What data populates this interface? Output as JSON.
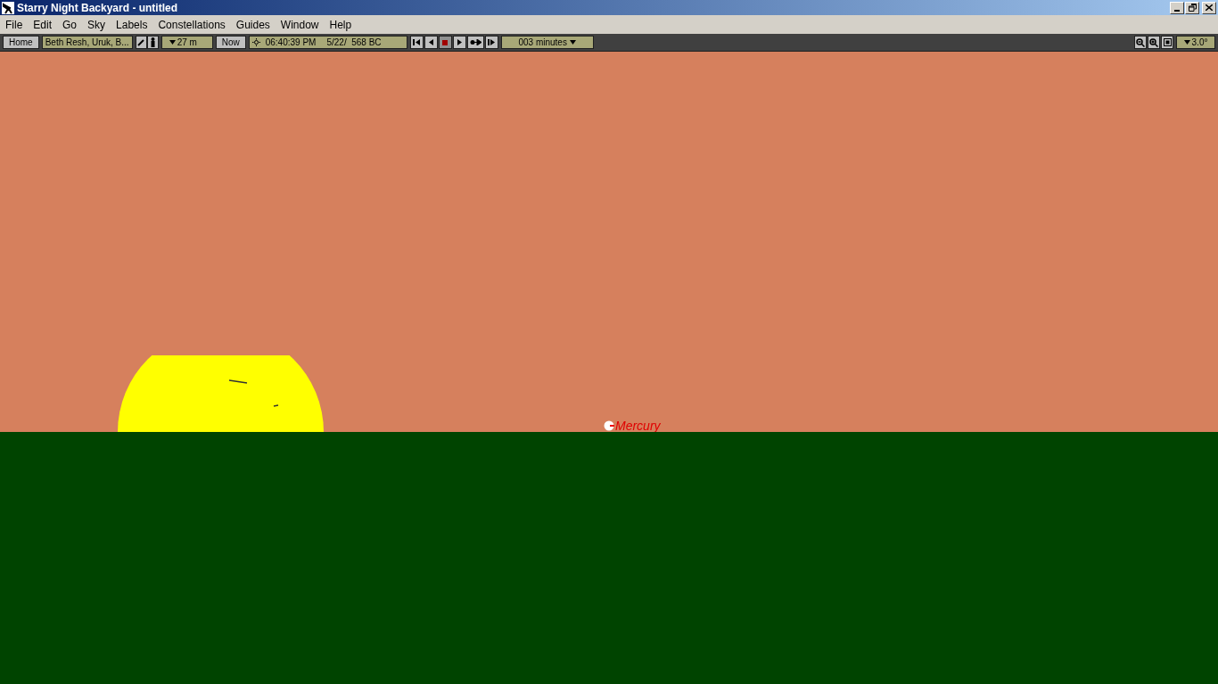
{
  "window": {
    "title": "Starry Night Backyard - untitled"
  },
  "menu": [
    "File",
    "Edit",
    "Go",
    "Sky",
    "Labels",
    "Constellations",
    "Guides",
    "Window",
    "Help"
  ],
  "toolbar": {
    "home": "Home",
    "location": "Beth Resh, Uruk, B...",
    "elevation": "27 m",
    "now": "Now",
    "time": "06:40:39 PM",
    "date": "5/22/  568 BC",
    "time_step": "003 minutes",
    "field_of_view": "3.0°"
  },
  "sky": {
    "labels": [
      {
        "kind": "planet",
        "text": "Mercury"
      }
    ]
  }
}
